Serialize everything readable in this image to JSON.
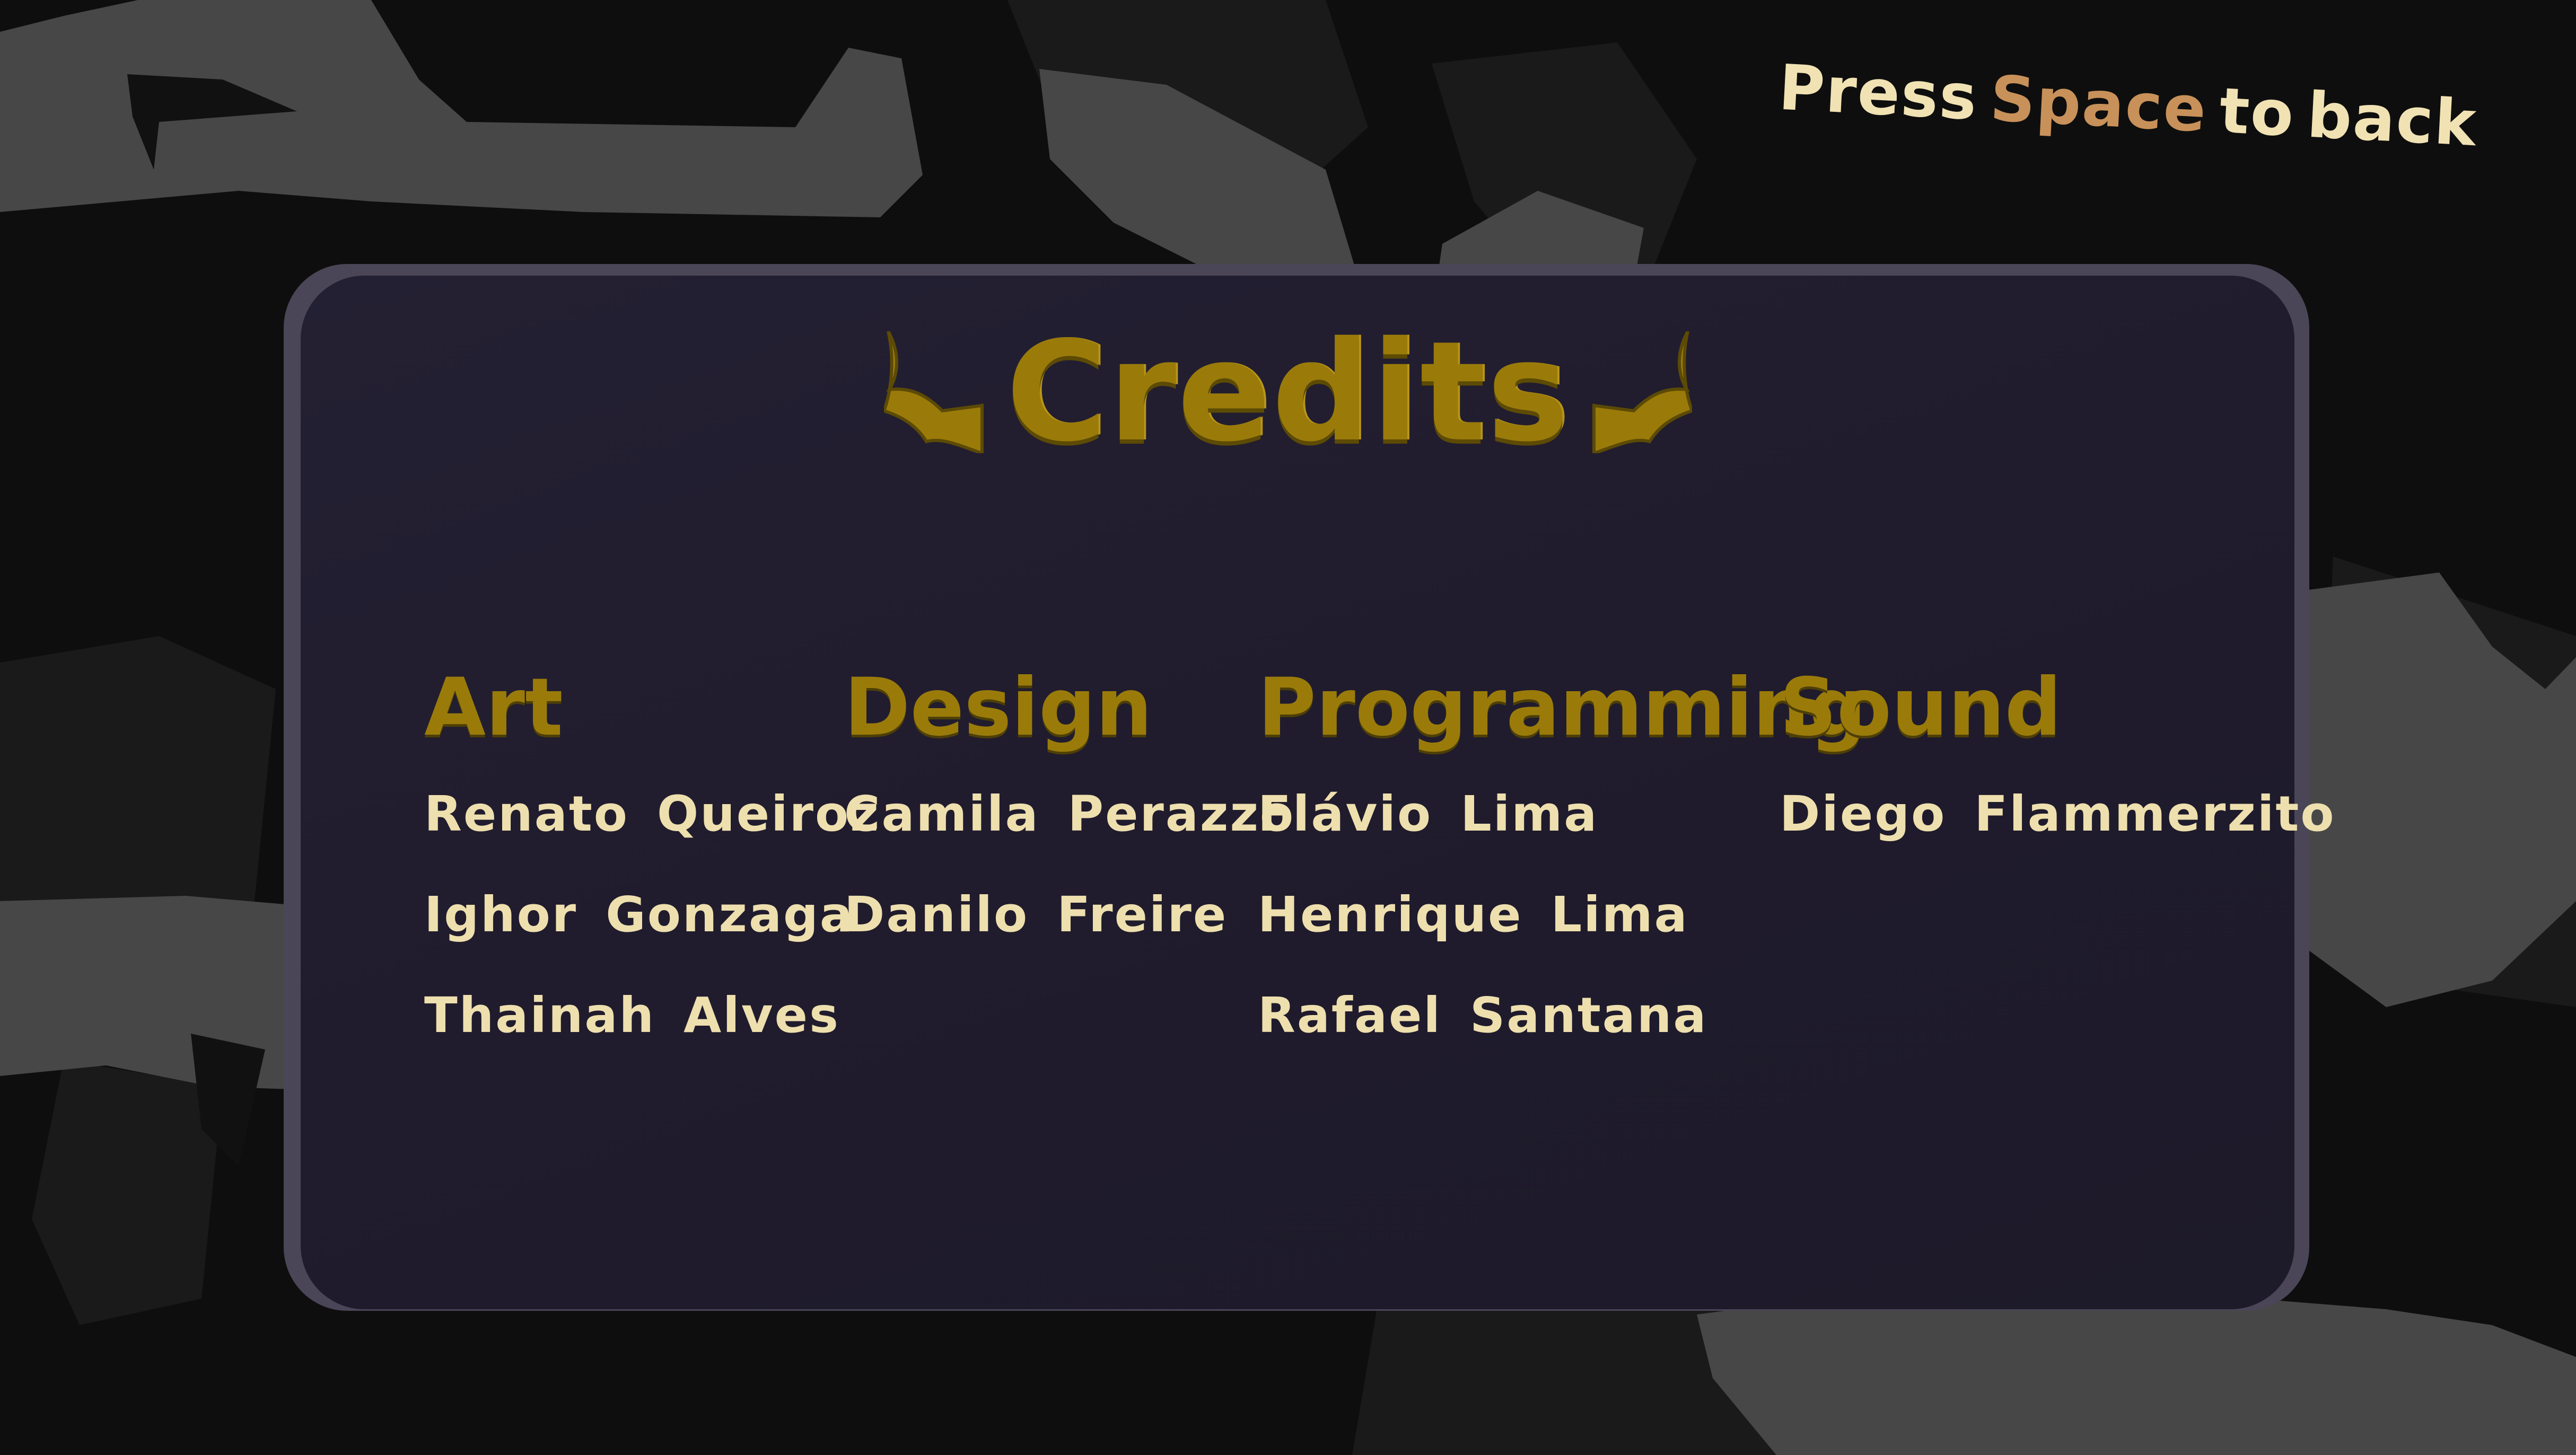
{
  "hint": {
    "press": "Press",
    "key": "Space",
    "to": "to",
    "back": "back"
  },
  "title": "Credits",
  "columns": [
    {
      "heading": "Art",
      "names": [
        "Renato Queiroz",
        "Ighor Gonzaga",
        "Thainah Alves"
      ]
    },
    {
      "heading": "Design",
      "names": [
        "Camila Perazzo",
        "Danilo Freire"
      ]
    },
    {
      "heading": "Programming",
      "names": [
        "Flávio Lima",
        "Henrique Lima",
        "Rafael Santana"
      ]
    },
    {
      "heading": "Sound",
      "names": [
        "Diego Flammerzito"
      ]
    }
  ],
  "colors": {
    "background": "#0e0e0e",
    "rock": "#474747",
    "panel": "#211d2f",
    "heading_gold": "#9a7b0a",
    "name_cream": "#eedfae",
    "key_highlight": "#c8915a"
  },
  "icons": {
    "title_decoration": "bat-wing-icon"
  }
}
